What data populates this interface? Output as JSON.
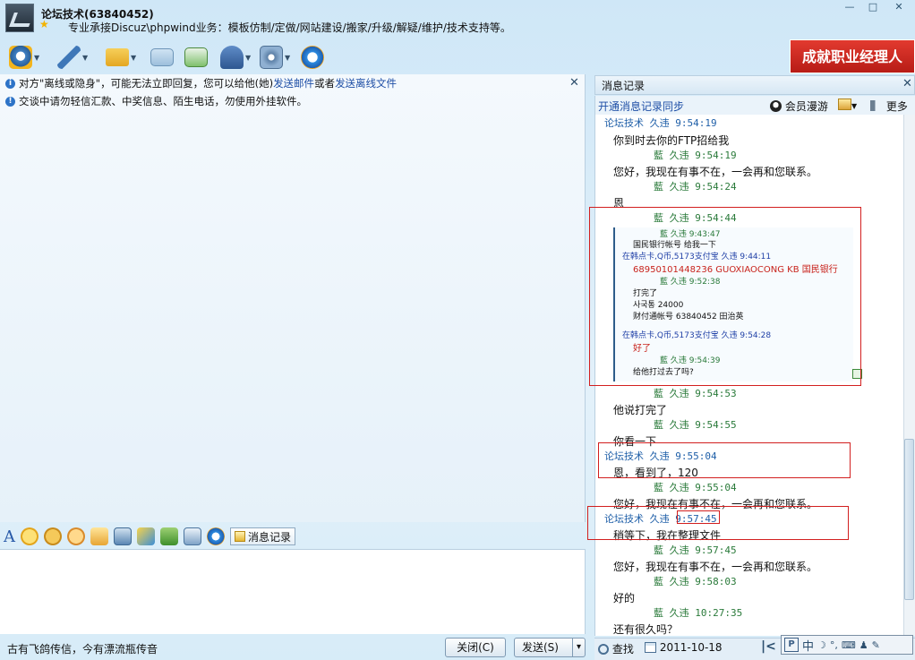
{
  "window": {
    "title": "论坛技术(63840452)",
    "signature": "专业承接Discuz\\phpwind业务：模板仿制/定做/网站建设/搬家/升级/解疑/维护/技术支持等。",
    "min_label": "—",
    "max_label": "□",
    "close_label": "✕"
  },
  "toolbar": {
    "icons": [
      "video-icon",
      "voice-icon",
      "folder-icon",
      "mail-icon",
      "sms-icon",
      "app-icon",
      "settings-icon",
      "sogou-icon"
    ]
  },
  "banner": {
    "text": "成就职业经理人"
  },
  "notices": {
    "offline_prefix": "对方\"离线或隐身\"，可能无法立即回复，您可以给他(她)",
    "send_mail": "发送邮件",
    "or": "或者",
    "send_offline_file": "发送离线文件",
    "security": "交谈中请勿轻信汇款、中奖信息、陌生电话，勿使用外挂软件。",
    "close": "✕"
  },
  "format_bar": {
    "font_label": "A",
    "message_record_label": "消息记录"
  },
  "bottom": {
    "proverb": "古有飞鸽传信，今有漂流瓶传音",
    "close_label": "关闭(C)",
    "send_label": "发送(S)",
    "dropdown": "▾"
  },
  "history": {
    "title": "消息记录",
    "close": "✕",
    "sync_link": "开通消息记录同步",
    "member_roam": "会员漫游",
    "more": "更多",
    "date": "2011-10-18",
    "find": "查找",
    "entries": [
      {
        "kind": "blue",
        "text": "论坛技术 久违 9:54:19"
      },
      {
        "kind": "msg",
        "text": "你到时去你的FTP招给我"
      },
      {
        "kind": "green",
        "text": "藍        久违 9:54:19"
      },
      {
        "kind": "msg",
        "text": "您好，我现在有事不在，一会再和您联系。"
      },
      {
        "kind": "green",
        "text": "藍        久违 9:54:24"
      },
      {
        "kind": "msg",
        "text": "恩"
      },
      {
        "kind": "green",
        "text": "藍        久违 9:54:44"
      },
      {
        "kind": "green",
        "text": "藍        久违 9:54:53"
      },
      {
        "kind": "msg",
        "text": "他说打完了"
      },
      {
        "kind": "green",
        "text": "藍        久违 9:54:55"
      },
      {
        "kind": "msg",
        "text": "你看一下"
      },
      {
        "kind": "blue",
        "text": "论坛技术 久违 9:55:04"
      },
      {
        "kind": "msg",
        "text": "恩，看到了，120"
      },
      {
        "kind": "green",
        "text": "藍        久违 9:55:04"
      },
      {
        "kind": "msg",
        "text": "您好，我现在有事不在，一会再和您联系。"
      },
      {
        "kind": "blue",
        "text": "论坛技术 久违 9:57:45"
      },
      {
        "kind": "msg",
        "text": "稍等下，我在整理文件"
      },
      {
        "kind": "green",
        "text": "藍        久违 9:57:45"
      },
      {
        "kind": "msg",
        "text": "您好，我现在有事不在，一会再和您联系。"
      },
      {
        "kind": "green",
        "text": "藍        久违 9:58:03"
      },
      {
        "kind": "msg",
        "text": "好的"
      },
      {
        "kind": "green",
        "text": "藍        久违 10:27:35"
      },
      {
        "kind": "msg",
        "text": "还有很久吗？"
      }
    ],
    "screenshot": {
      "l1": "藍         久违 9:43:47",
      "l2": "国民银行帐号  给我一下",
      "l3": "在韩点卡,Q币,5173支付宝   久违 9:44:11",
      "l4": "68950101448236 GUOXIAOCONG KB 国民银行",
      "l5": "藍         久违 9:52:38",
      "l6": "打完了",
      "l7": "사국통  24000",
      "l8": "财付通帐号 63840452  田治英",
      "l9": "在韩点卡,Q币,5173支付宝   久违 9:54:28",
      "l10": "好了",
      "l11": "藍         久违 9:54:39",
      "l12": "给他打过去了吗?"
    }
  },
  "ime": {
    "label": "中"
  }
}
